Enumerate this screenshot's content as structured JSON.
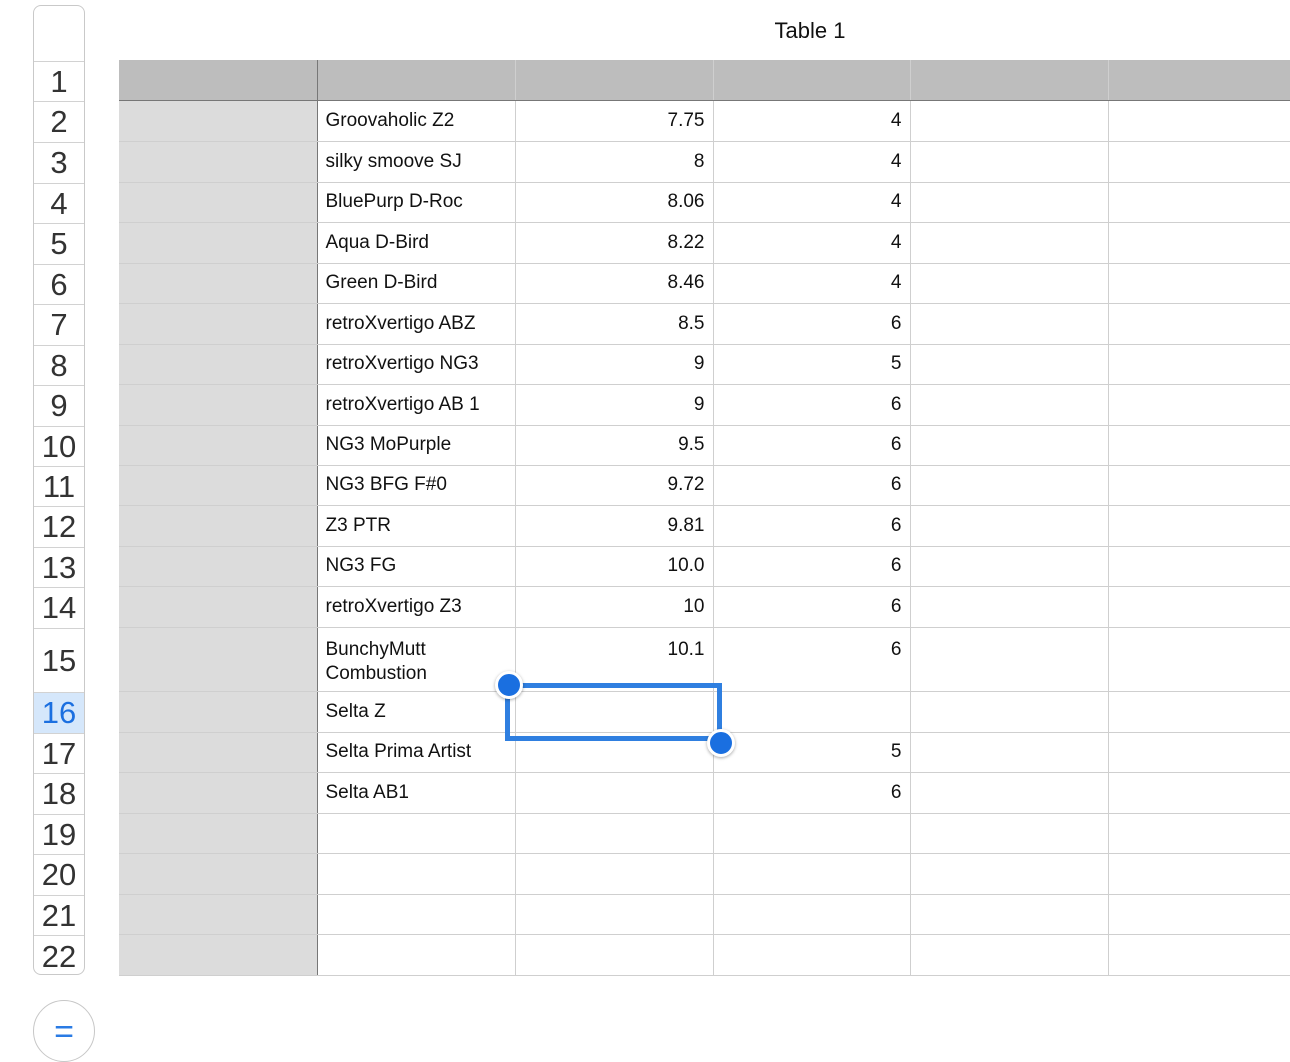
{
  "table": {
    "title": "Table 1"
  },
  "row_numbers": [
    "1",
    "2",
    "3",
    "4",
    "5",
    "6",
    "7",
    "8",
    "9",
    "10",
    "11",
    "12",
    "13",
    "14",
    "15",
    "16",
    "17",
    "18",
    "19",
    "20",
    "21",
    "22"
  ],
  "selected_row": "16",
  "rows": [
    {
      "name": "Groovaholic Z2",
      "value": "7.75",
      "count": "4"
    },
    {
      "name": "silky smoove SJ",
      "value": "8",
      "count": "4"
    },
    {
      "name": "BluePurp D-Roc",
      "value": "8.06",
      "count": "4"
    },
    {
      "name": "Aqua D-Bird",
      "value": "8.22",
      "count": "4"
    },
    {
      "name": "Green D-Bird",
      "value": "8.46",
      "count": "4"
    },
    {
      "name": "retroXvertigo ABZ",
      "value": "8.5",
      "count": "6"
    },
    {
      "name": "retroXvertigo NG3",
      "value": "9",
      "count": "5"
    },
    {
      "name": "retroXvertigo AB 1",
      "value": "9",
      "count": "6"
    },
    {
      "name": "NG3 MoPurple",
      "value": "9.5",
      "count": "6"
    },
    {
      "name": "NG3 BFG F#0",
      "value": "9.72",
      "count": "6"
    },
    {
      "name": "Z3 PTR",
      "value": "9.81",
      "count": "6"
    },
    {
      "name": "NG3 FG",
      "value": "10.0",
      "count": "6"
    },
    {
      "name": "retroXvertigo Z3",
      "value": "10",
      "count": "6"
    },
    {
      "name": "BunchyMutt Combustion",
      "value": "10.1",
      "count": "6"
    },
    {
      "name": "Selta Z",
      "value": "",
      "count": ""
    },
    {
      "name": "Selta Prima Artist",
      "value": "",
      "count": "5"
    },
    {
      "name": "Selta AB1",
      "value": "",
      "count": "6"
    },
    {
      "name": "",
      "value": "",
      "count": ""
    },
    {
      "name": "",
      "value": "",
      "count": ""
    },
    {
      "name": "",
      "value": "",
      "count": ""
    },
    {
      "name": "",
      "value": "",
      "count": ""
    }
  ],
  "toolbar": {
    "formula_button": "="
  },
  "colors": {
    "accent": "#2f7fe0",
    "header_fill": "#bdbdbd",
    "row_header_fill": "#dcdcdc",
    "selected_row_fill": "#d5e7fb"
  }
}
